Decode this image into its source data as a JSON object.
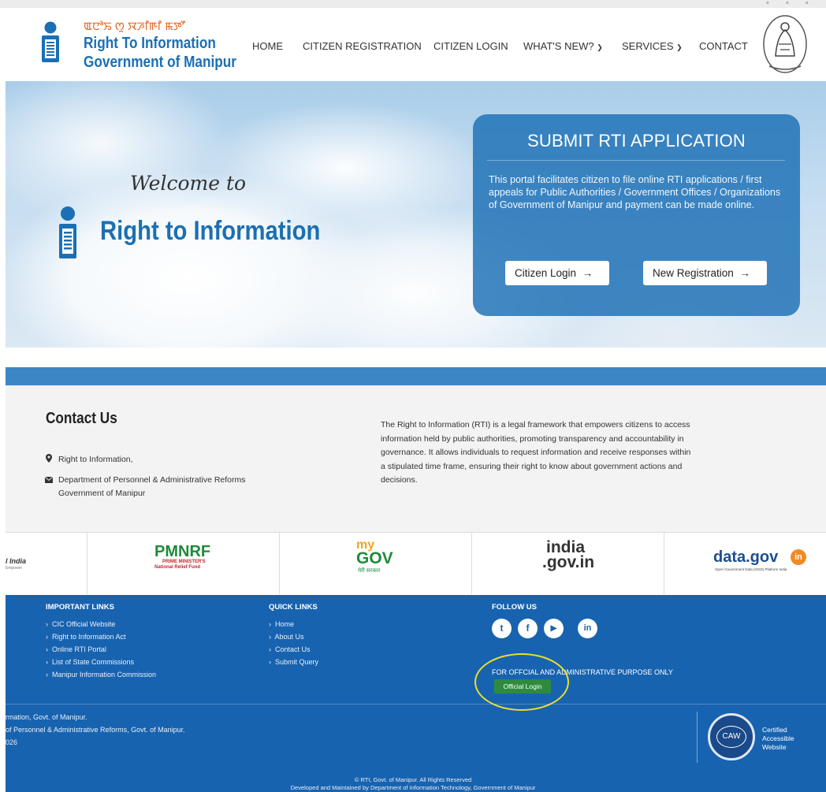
{
  "header": {
    "corner_icons": "◦ ◦ ◦",
    "brand_script": "ꯑꯅꯣꯢ ꯁꯨ ꯋꯍꯤꯒꯤ ꯃꯇꯧ",
    "brand_line1": "Right To Information",
    "brand_line2": "Government of Manipur",
    "nav": {
      "home": "HOME",
      "citizen_registration": "CITIZEN REGISTRATION",
      "citizen_login": "CITIZEN LOGIN",
      "whats_new": "WHAT'S NEW?",
      "services": "SERVICES",
      "contact": "CONTACT"
    }
  },
  "hero": {
    "welcome": "Welcome to",
    "title": "Right to Information",
    "panel_title": "SUBMIT RTI APPLICATION",
    "panel_text": "This portal facilitates citizen to file online RTI applications / first appeals for Public Authorities / Government Offices / Organizations of Government of Manipur and payment can be made online.",
    "citizen_login_label": "Citizen Login",
    "new_registration_label": "New Registration",
    "arrow": "→"
  },
  "contact": {
    "title": "Contact Us",
    "line1": "Right to Information,",
    "line2": "Department of Personnel & Administrative Reforms",
    "line3": "Government of Manipur",
    "about": "The Right to Information (RTI) is a legal framework that empowers citizens to access information held by public authorities, promoting transparency and accountability in governance. It allows individuals to request information and receive responses within a stipulated time frame, ensuring their right to know about government actions and decisions."
  },
  "partners": {
    "digital_india_partial": "l India",
    "digital_india_sub": "Empower",
    "pmnrf": "PMNRF",
    "pmnrf_sub1": "PRIME MINISTER'S",
    "pmnrf_sub2": "National Relief Fund",
    "mygov_my": "my",
    "mygov_gov": "GOV",
    "mygov_sub": "मेरी सरकार",
    "india_gov_1": "india",
    "india_gov_2": ".gov.in",
    "datagov": "data.gov",
    "datagov_in": "in",
    "datagov_sub": "Open Government Data (OGD) Platform India"
  },
  "footer": {
    "important_links_title": "IMPORTANT LINKS",
    "important_links": [
      "CIC Official Website",
      "Right to Information Act",
      "Online RTI Portal",
      "List of State Commissions",
      "Manipur Information Commission"
    ],
    "quick_links_title": "QUICK LINKS",
    "quick_links": [
      "Home",
      "About Us",
      "Contact Us",
      "Submit Query"
    ],
    "follow_us_title": "FOLLOW US",
    "social": {
      "twitter": "t",
      "facebook": "f",
      "youtube": "▶",
      "linkedin": "in"
    },
    "official_text": "FOR OFFCIAL AND ADMINISTRATIVE PURPOSE ONLY",
    "official_login": "Official Login",
    "addr1": "rmation, Govt. of Manipur.",
    "addr2": "of Personnel & Administrative Reforms, Govt. of Manipur.",
    "addr3": "026",
    "caw_badge": "CAW",
    "caw_label1": "Certified",
    "caw_label2": "Accessible",
    "caw_label3": "Website",
    "copyright": "© RTI, Govt. of Manipur. All Rights Reserved",
    "developed": "Developed and Maintained by Department of Information Technology, Government of Manipur"
  }
}
